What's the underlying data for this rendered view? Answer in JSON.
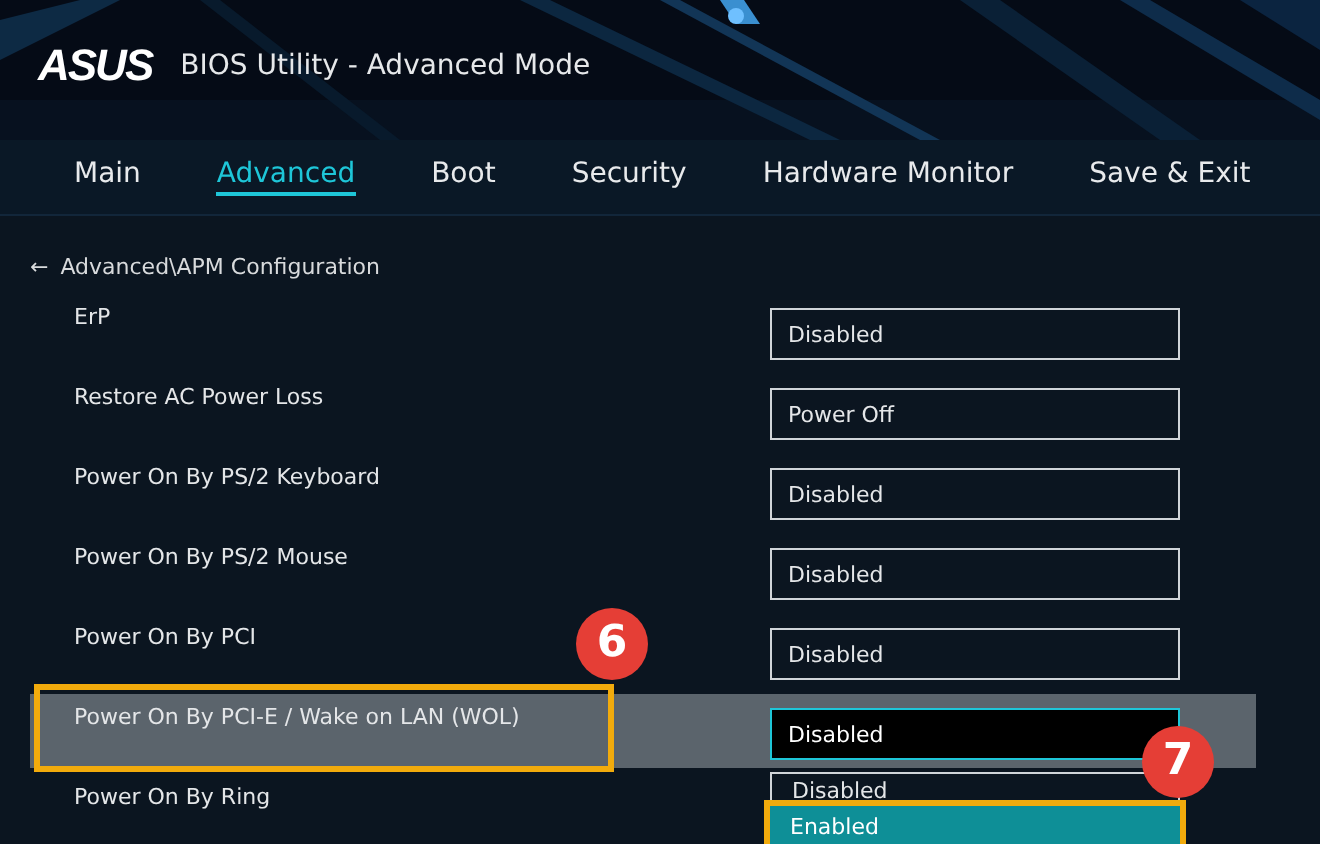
{
  "header": {
    "logo": "ASUS",
    "title": "BIOS Utility - Advanced Mode"
  },
  "tabs": [
    {
      "label": "Main",
      "selected": false
    },
    {
      "label": "Advanced",
      "selected": true
    },
    {
      "label": "Boot",
      "selected": false
    },
    {
      "label": "Security",
      "selected": false
    },
    {
      "label": "Hardware Monitor",
      "selected": false
    },
    {
      "label": "Save & Exit",
      "selected": false
    }
  ],
  "breadcrumb": {
    "back": "←",
    "path": "Advanced\\APM Configuration"
  },
  "settings": [
    {
      "label": "ErP",
      "value": "Disabled",
      "selected": false
    },
    {
      "label": "Restore AC Power Loss",
      "value": "Power Off",
      "selected": false
    },
    {
      "label": "Power On By PS/2 Keyboard",
      "value": "Disabled",
      "selected": false
    },
    {
      "label": "Power On By PS/2 Mouse",
      "value": "Disabled",
      "selected": false
    },
    {
      "label": "Power On By PCI",
      "value": "Disabled",
      "selected": false
    },
    {
      "label": "Power On By PCI-E / Wake on LAN (WOL)",
      "value": "Disabled",
      "selected": true,
      "highlighted": true
    },
    {
      "label": "Power On By Ring",
      "selected": false
    }
  ],
  "dropdown": {
    "options": [
      {
        "label": "Disabled",
        "selected": false,
        "highlighted": false
      },
      {
        "label": "Enabled",
        "selected": true,
        "highlighted": true
      }
    ]
  },
  "callouts": [
    {
      "label": "6"
    },
    {
      "label": "7"
    }
  ]
}
